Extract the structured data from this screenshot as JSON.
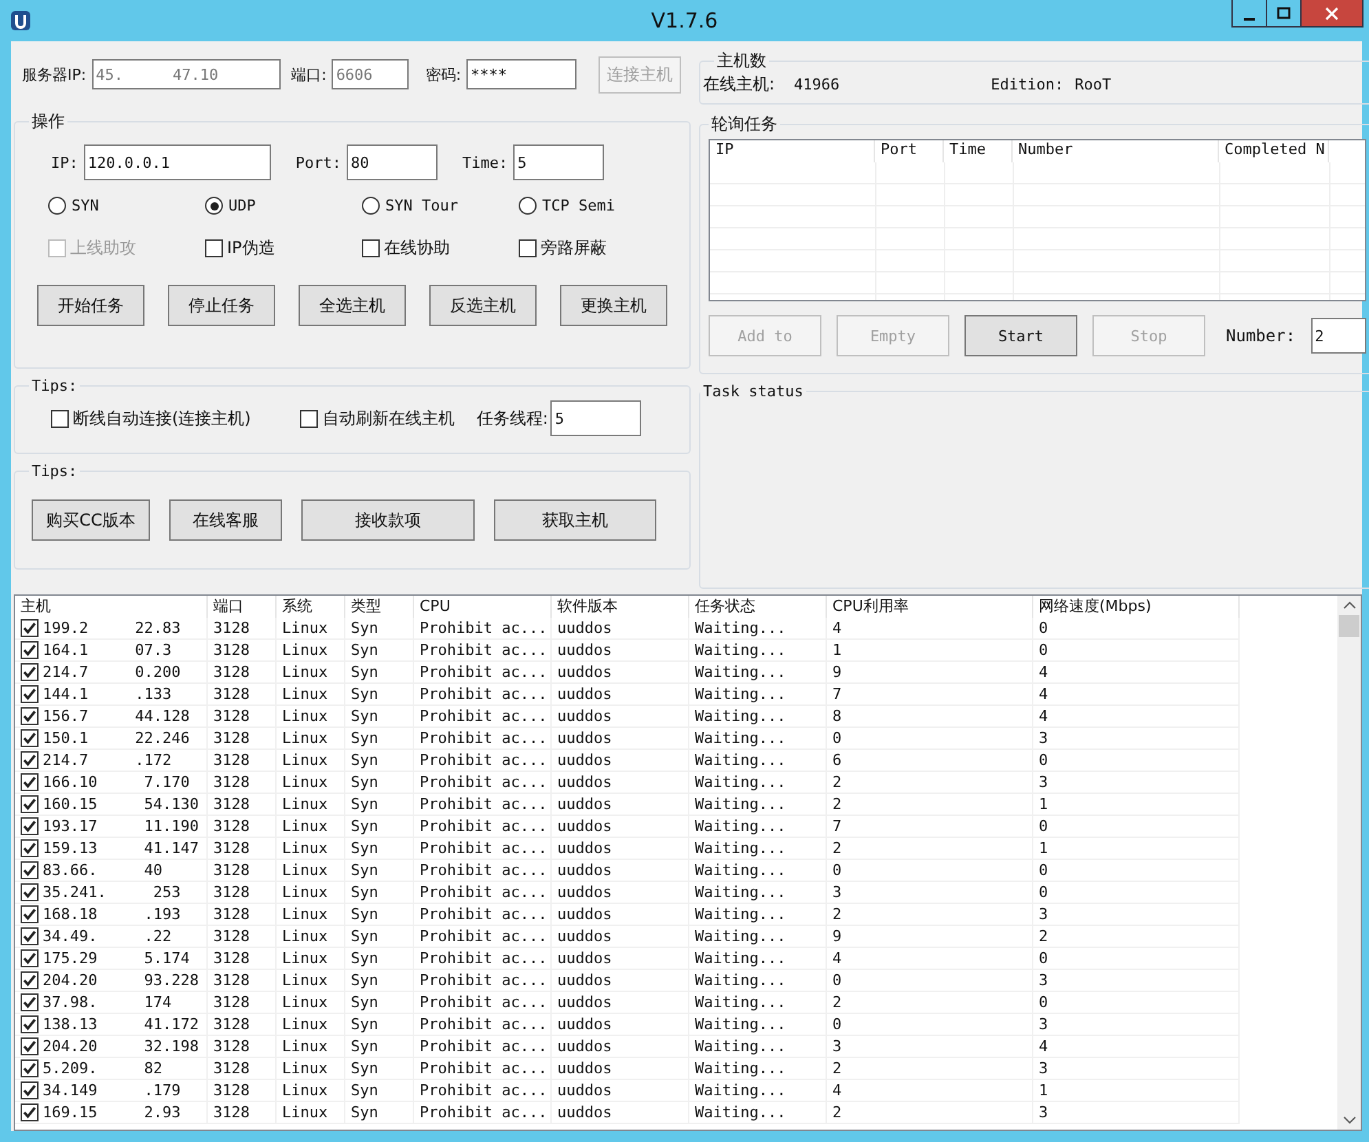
{
  "window": {
    "title": "V1.7.6"
  },
  "server": {
    "ip_label": "服务器IP:",
    "ip_parts": [
      "45.",
      "47.10"
    ],
    "port_label": "端口:",
    "port": "6606",
    "password_label": "密码:",
    "password": "****",
    "connect_button": {
      "label": "连接主机",
      "disabled": true
    }
  },
  "operation": {
    "title": "操作",
    "fields": [
      {
        "label": "IP:",
        "value": "120.0.0.1"
      },
      {
        "label": "Port:",
        "value": "80"
      },
      {
        "label": "Time:",
        "value": "5"
      }
    ],
    "modes": [
      {
        "label": "SYN",
        "selected": false
      },
      {
        "label": "UDP",
        "selected": true
      },
      {
        "label": "SYN Tour",
        "selected": false
      },
      {
        "label": "TCP Semi",
        "selected": false
      }
    ],
    "options": [
      {
        "label": "上线助攻",
        "checked": false,
        "disabled": true
      },
      {
        "label": "IP伪造",
        "checked": false,
        "disabled": false
      },
      {
        "label": "在线协助",
        "checked": false,
        "disabled": false
      },
      {
        "label": "旁路屏蔽",
        "checked": false,
        "disabled": false
      }
    ],
    "buttons": [
      "开始任务",
      "停止任务",
      "全选主机",
      "反选主机",
      "更换主机"
    ]
  },
  "tips1": {
    "title": "Tips:",
    "options": [
      {
        "label": "断线自动连接(连接主机)",
        "checked": false
      },
      {
        "label": "自动刷新在线主机",
        "checked": false
      }
    ],
    "threads_label": "任务线程:",
    "threads": "5"
  },
  "tips2": {
    "title": "Tips:",
    "buttons": [
      "购买CC版本",
      "在线客服",
      "接收款项",
      "获取主机"
    ]
  },
  "host_count": {
    "title": "主机数",
    "online_label": "在线主机:",
    "online": "41966",
    "edition_label": "Edition:",
    "edition": "RooT"
  },
  "polling": {
    "title": "轮询任务",
    "columns": [
      "IP",
      "Port",
      "Time",
      "Number",
      "Completed N"
    ],
    "buttons": [
      {
        "label": "Add to",
        "disabled": true
      },
      {
        "label": "Empty",
        "disabled": true
      },
      {
        "label": "Start",
        "disabled": false
      },
      {
        "label": "Stop",
        "disabled": true
      }
    ],
    "number_label": "Number:",
    "number": "2"
  },
  "task_status": {
    "title": "Task status"
  },
  "hosts": {
    "columns": [
      "主机",
      "端口",
      "系统",
      "类型",
      "CPU",
      "软件版本",
      "任务状态",
      "CPU利用率",
      "网络速度(Mbps)"
    ],
    "rows": [
      {
        "checked": true,
        "host": [
          "199.2",
          "22.83"
        ],
        "port": "3128",
        "os": "Linux",
        "type": "Syn",
        "cpu": "Prohibit ac...",
        "version": "uuddos",
        "status": "Waiting...",
        "cpu_usage": "4",
        "net_speed": "0"
      },
      {
        "checked": true,
        "host": [
          "164.1",
          "07.3"
        ],
        "port": "3128",
        "os": "Linux",
        "type": "Syn",
        "cpu": "Prohibit ac...",
        "version": "uuddos",
        "status": "Waiting...",
        "cpu_usage": "1",
        "net_speed": "0"
      },
      {
        "checked": true,
        "host": [
          "214.7",
          "0.200"
        ],
        "port": "3128",
        "os": "Linux",
        "type": "Syn",
        "cpu": "Prohibit ac...",
        "version": "uuddos",
        "status": "Waiting...",
        "cpu_usage": "9",
        "net_speed": "4"
      },
      {
        "checked": true,
        "host": [
          "144.1",
          ".133"
        ],
        "port": "3128",
        "os": "Linux",
        "type": "Syn",
        "cpu": "Prohibit ac...",
        "version": "uuddos",
        "status": "Waiting...",
        "cpu_usage": "7",
        "net_speed": "4"
      },
      {
        "checked": true,
        "host": [
          "156.7",
          "44.128"
        ],
        "port": "3128",
        "os": "Linux",
        "type": "Syn",
        "cpu": "Prohibit ac...",
        "version": "uuddos",
        "status": "Waiting...",
        "cpu_usage": "8",
        "net_speed": "4"
      },
      {
        "checked": true,
        "host": [
          "150.1",
          "22.246"
        ],
        "port": "3128",
        "os": "Linux",
        "type": "Syn",
        "cpu": "Prohibit ac...",
        "version": "uuddos",
        "status": "Waiting...",
        "cpu_usage": "0",
        "net_speed": "3"
      },
      {
        "checked": true,
        "host": [
          "214.7",
          ".172"
        ],
        "port": "3128",
        "os": "Linux",
        "type": "Syn",
        "cpu": "Prohibit ac...",
        "version": "uuddos",
        "status": "Waiting...",
        "cpu_usage": "6",
        "net_speed": "0"
      },
      {
        "checked": true,
        "host": [
          "166.10",
          "7.170"
        ],
        "port": "3128",
        "os": "Linux",
        "type": "Syn",
        "cpu": "Prohibit ac...",
        "version": "uuddos",
        "status": "Waiting...",
        "cpu_usage": "2",
        "net_speed": "3"
      },
      {
        "checked": true,
        "host": [
          "160.15",
          "54.130"
        ],
        "port": "3128",
        "os": "Linux",
        "type": "Syn",
        "cpu": "Prohibit ac...",
        "version": "uuddos",
        "status": "Waiting...",
        "cpu_usage": "2",
        "net_speed": "1"
      },
      {
        "checked": true,
        "host": [
          "193.17",
          "11.190"
        ],
        "port": "3128",
        "os": "Linux",
        "type": "Syn",
        "cpu": "Prohibit ac...",
        "version": "uuddos",
        "status": "Waiting...",
        "cpu_usage": "7",
        "net_speed": "0"
      },
      {
        "checked": true,
        "host": [
          "159.13",
          "41.147"
        ],
        "port": "3128",
        "os": "Linux",
        "type": "Syn",
        "cpu": "Prohibit ac...",
        "version": "uuddos",
        "status": "Waiting...",
        "cpu_usage": "2",
        "net_speed": "1"
      },
      {
        "checked": true,
        "host": [
          "83.66.",
          "40"
        ],
        "port": "3128",
        "os": "Linux",
        "type": "Syn",
        "cpu": "Prohibit ac...",
        "version": "uuddos",
        "status": "Waiting...",
        "cpu_usage": "0",
        "net_speed": "0"
      },
      {
        "checked": true,
        "host": [
          "35.241.",
          "253"
        ],
        "port": "3128",
        "os": "Linux",
        "type": "Syn",
        "cpu": "Prohibit ac...",
        "version": "uuddos",
        "status": "Waiting...",
        "cpu_usage": "3",
        "net_speed": "0"
      },
      {
        "checked": true,
        "host": [
          "168.18",
          ".193"
        ],
        "port": "3128",
        "os": "Linux",
        "type": "Syn",
        "cpu": "Prohibit ac...",
        "version": "uuddos",
        "status": "Waiting...",
        "cpu_usage": "2",
        "net_speed": "3"
      },
      {
        "checked": true,
        "host": [
          "34.49.",
          ".22"
        ],
        "port": "3128",
        "os": "Linux",
        "type": "Syn",
        "cpu": "Prohibit ac...",
        "version": "uuddos",
        "status": "Waiting...",
        "cpu_usage": "9",
        "net_speed": "2"
      },
      {
        "checked": true,
        "host": [
          "175.29",
          "5.174"
        ],
        "port": "3128",
        "os": "Linux",
        "type": "Syn",
        "cpu": "Prohibit ac...",
        "version": "uuddos",
        "status": "Waiting...",
        "cpu_usage": "4",
        "net_speed": "0"
      },
      {
        "checked": true,
        "host": [
          "204.20",
          "93.228"
        ],
        "port": "3128",
        "os": "Linux",
        "type": "Syn",
        "cpu": "Prohibit ac...",
        "version": "uuddos",
        "status": "Waiting...",
        "cpu_usage": "0",
        "net_speed": "3"
      },
      {
        "checked": true,
        "host": [
          "37.98.",
          "174"
        ],
        "port": "3128",
        "os": "Linux",
        "type": "Syn",
        "cpu": "Prohibit ac...",
        "version": "uuddos",
        "status": "Waiting...",
        "cpu_usage": "2",
        "net_speed": "0"
      },
      {
        "checked": true,
        "host": [
          "138.13",
          "41.172"
        ],
        "port": "3128",
        "os": "Linux",
        "type": "Syn",
        "cpu": "Prohibit ac...",
        "version": "uuddos",
        "status": "Waiting...",
        "cpu_usage": "0",
        "net_speed": "3"
      },
      {
        "checked": true,
        "host": [
          "204.20",
          "32.198"
        ],
        "port": "3128",
        "os": "Linux",
        "type": "Syn",
        "cpu": "Prohibit ac...",
        "version": "uuddos",
        "status": "Waiting...",
        "cpu_usage": "3",
        "net_speed": "4"
      },
      {
        "checked": true,
        "host": [
          "5.209.",
          "82"
        ],
        "port": "3128",
        "os": "Linux",
        "type": "Syn",
        "cpu": "Prohibit ac...",
        "version": "uuddos",
        "status": "Waiting...",
        "cpu_usage": "2",
        "net_speed": "3"
      },
      {
        "checked": true,
        "host": [
          "34.149",
          ".179"
        ],
        "port": "3128",
        "os": "Linux",
        "type": "Syn",
        "cpu": "Prohibit ac...",
        "version": "uuddos",
        "status": "Waiting...",
        "cpu_usage": "4",
        "net_speed": "1"
      },
      {
        "checked": true,
        "host": [
          "169.15",
          "2.93"
        ],
        "port": "3128",
        "os": "Linux",
        "type": "Syn",
        "cpu": "Prohibit ac...",
        "version": "uuddos",
        "status": "Waiting...",
        "cpu_usage": "2",
        "net_speed": "3"
      }
    ]
  }
}
